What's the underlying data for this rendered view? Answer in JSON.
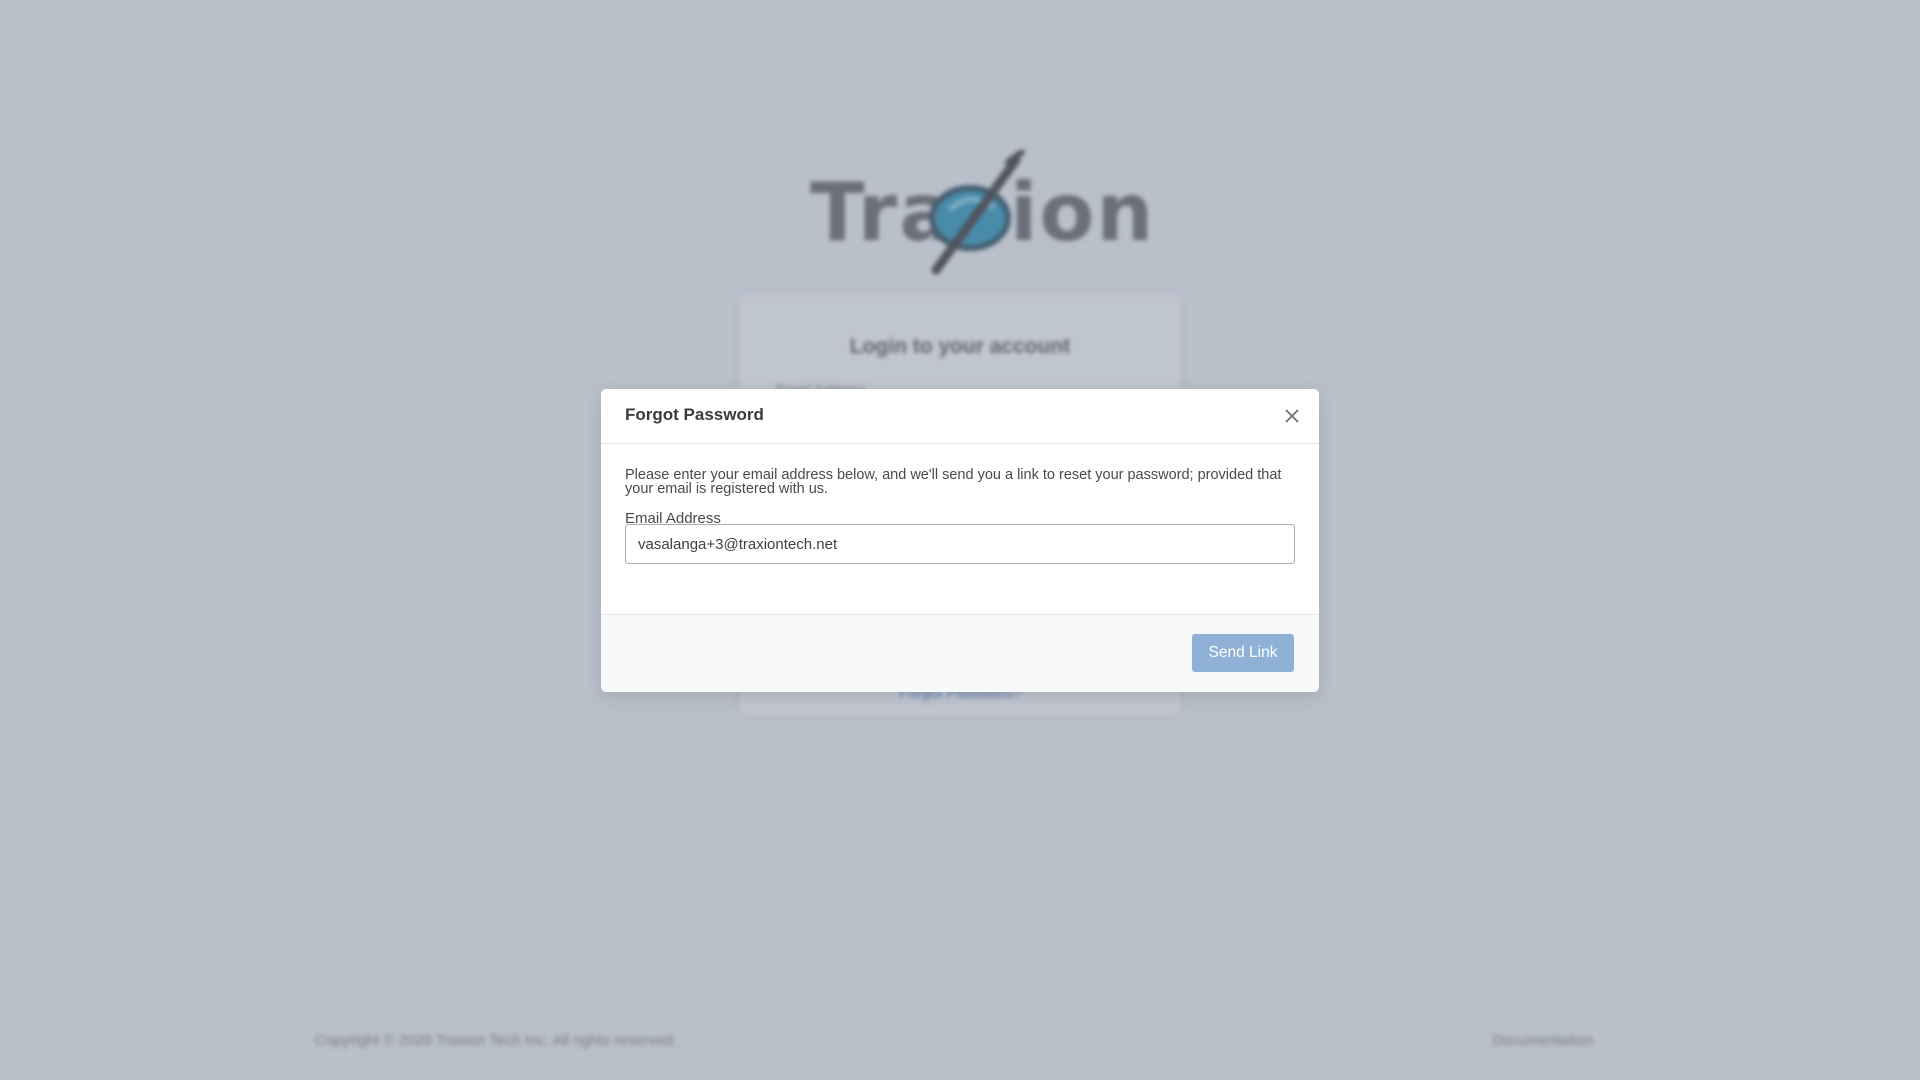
{
  "background": {
    "logo": {
      "text_left": "Tra",
      "text_right": "ion"
    },
    "login_card": {
      "title": "Login to your account",
      "field_label": "Email Address",
      "forgot_link": "Forgot Password?"
    },
    "footer": {
      "copyright": "Copyright © 2020 Traxion Tech Inc. All rights reserved.",
      "documentation": "Documentation"
    }
  },
  "modal": {
    "title": "Forgot Password",
    "description": "Please enter your email address below, and we'll send you a link to reset your password; provided that your email is registered with us.",
    "email_label": "Email Address",
    "email_value": "vasalanga+3@traxiontech.net",
    "send_button": "Send Link"
  },
  "colors": {
    "overlay": "#7d879b",
    "primary_button": "#8fb1d6",
    "logo_teal": "#1e8fb5"
  },
  "icons": {
    "close": "close-icon"
  }
}
